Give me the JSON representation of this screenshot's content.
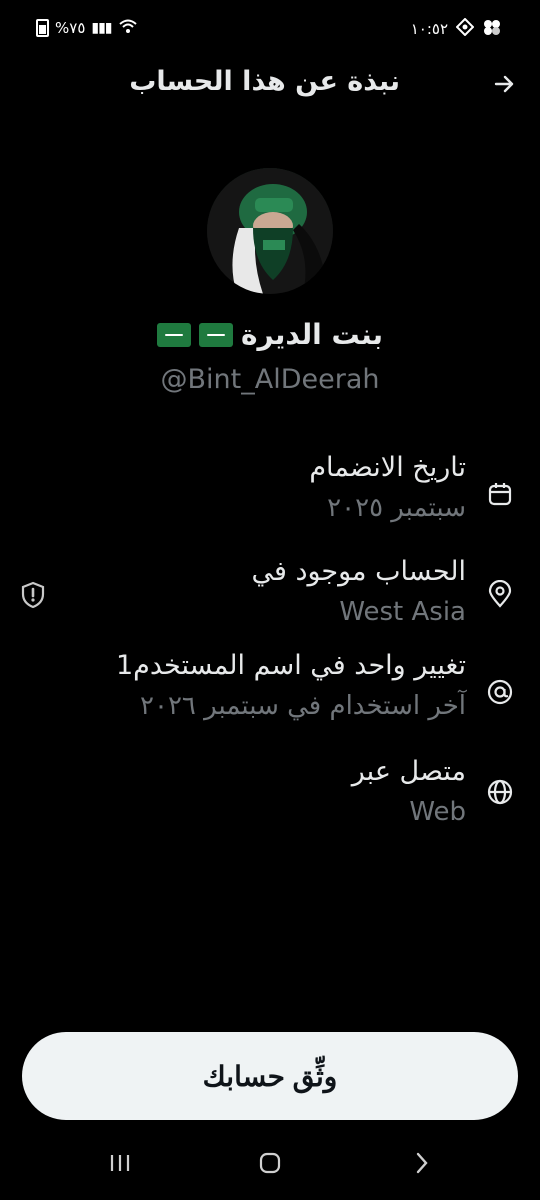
{
  "status_bar": {
    "battery_text": "%٧٥",
    "time": "١٠:٥٢"
  },
  "header": {
    "title": "نبذة عن هذا الحساب"
  },
  "profile": {
    "display_name": "بنت الديرة",
    "handle": "@Bint_AlDeerah"
  },
  "details": [
    {
      "title": "تاريخ الانضمام",
      "subtitle": "سبتمبر ٢٠٢٥",
      "icon": "calendar-icon"
    },
    {
      "title": "الحساب موجود في",
      "subtitle": "West Asia",
      "icon": "location-pin-icon"
    },
    {
      "title": "تغيير واحد في اسم المستخدم1",
      "subtitle": "آخر استخدام في سبتمبر ٢٠٢٦",
      "icon": "at-sign-icon"
    },
    {
      "title": "متصل عبر",
      "subtitle": "Web",
      "icon": "globe-icon"
    }
  ],
  "verify_button": {
    "label": "وثِّق حسابك"
  },
  "colors": {
    "background": "#000000",
    "text": "#e7e9ea",
    "muted": "#71767b",
    "button_bg": "#eff3f4"
  }
}
